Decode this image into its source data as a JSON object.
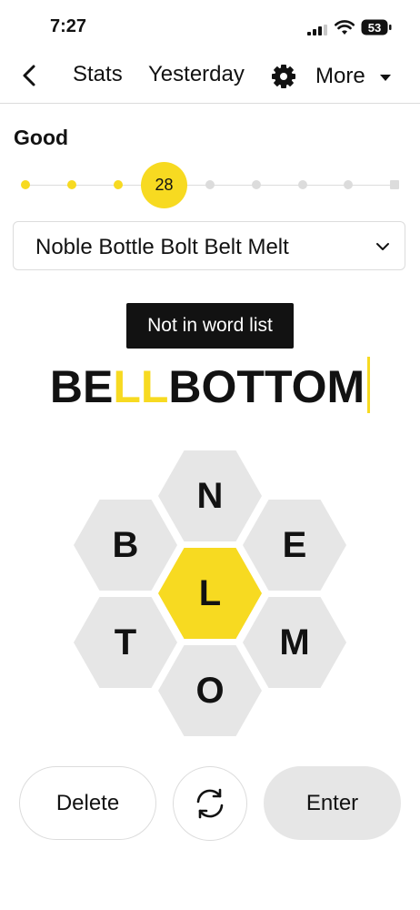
{
  "status": {
    "time": "7:27",
    "battery": "53"
  },
  "nav": {
    "back_icon": "chevron-left-icon",
    "stats": "Stats",
    "yesterday": "Yesterday",
    "settings_icon": "gear-icon",
    "more": "More"
  },
  "rank": {
    "label": "Good",
    "score": "28",
    "progress_level": 3,
    "levels": 9
  },
  "found_words": {
    "text": "Noble Bottle Bolt Belt Melt"
  },
  "toast": {
    "message": "Not in word list"
  },
  "entry": {
    "prefix": "BE",
    "highlight": "LL",
    "suffix": "BOTTOM"
  },
  "hive": {
    "center": "L",
    "top": "N",
    "upper_left": "B",
    "upper_right": "E",
    "lower_left": "T",
    "lower_right": "M",
    "bottom": "O"
  },
  "buttons": {
    "delete": "Delete",
    "shuffle_icon": "shuffle-icon",
    "enter": "Enter"
  },
  "colors": {
    "accent": "#f7da21",
    "cell": "#e6e6e6",
    "text": "#121212"
  }
}
